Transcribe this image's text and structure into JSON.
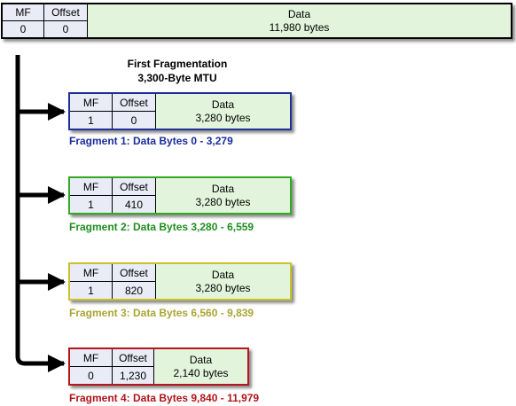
{
  "original": {
    "mf_header": "MF",
    "offset_header": "Offset",
    "mf": "0",
    "offset": "0",
    "data_header": "Data",
    "data_size": "11,980 bytes"
  },
  "title": {
    "line1": "First Fragmentation",
    "line2": "3,300-Byte MTU"
  },
  "fragments": [
    {
      "mf_header": "MF",
      "offset_header": "Offset",
      "mf": "1",
      "offset": "0",
      "data_header": "Data",
      "data_size": "3,280 bytes",
      "caption": "Fragment 1: Data Bytes 0 - 3,279",
      "color": "#1f2f9a"
    },
    {
      "mf_header": "MF",
      "offset_header": "Offset",
      "mf": "1",
      "offset": "410",
      "data_header": "Data",
      "data_size": "3,280 bytes",
      "caption": "Fragment 2: Data Bytes 3,280 - 6,559",
      "color": "#2fab1f"
    },
    {
      "mf_header": "MF",
      "offset_header": "Offset",
      "mf": "1",
      "offset": "820",
      "data_header": "Data",
      "data_size": "3,280 bytes",
      "caption": "Fragment 3: Data Bytes 6,560 - 9,839",
      "color": "#c9c22a"
    },
    {
      "mf_header": "MF",
      "offset_header": "Offset",
      "mf": "0",
      "offset": "1,230",
      "data_header": "Data",
      "data_size": "2,140 bytes",
      "caption": "Fragment 4: Data Bytes 9,840 - 11,979",
      "color": "#b8151b"
    }
  ]
}
